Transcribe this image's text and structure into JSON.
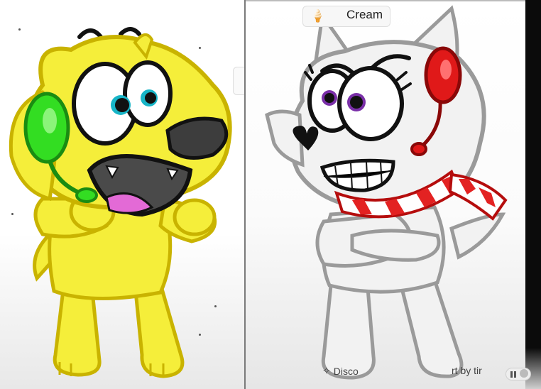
{
  "right_panel": {
    "flavor_chip": {
      "label": "Cream",
      "icon": "ice-cream-icon"
    },
    "bottom_bar": {
      "discover_label": "Disco",
      "discover_icon": "sparkle-icon",
      "sort_label": "rt by tir",
      "pause_icon": "pause-icon"
    }
  },
  "colors": {
    "dog_body": "#f5ee3a",
    "dog_outline": "#c9b300",
    "headset_green": "#33dd22",
    "wolf_body": "#f2f2f2",
    "headset_red": "#e01919",
    "scarf_red": "#e32222",
    "eye_purple": "#7a2fa8",
    "eye_cyan": "#18b5c7"
  }
}
